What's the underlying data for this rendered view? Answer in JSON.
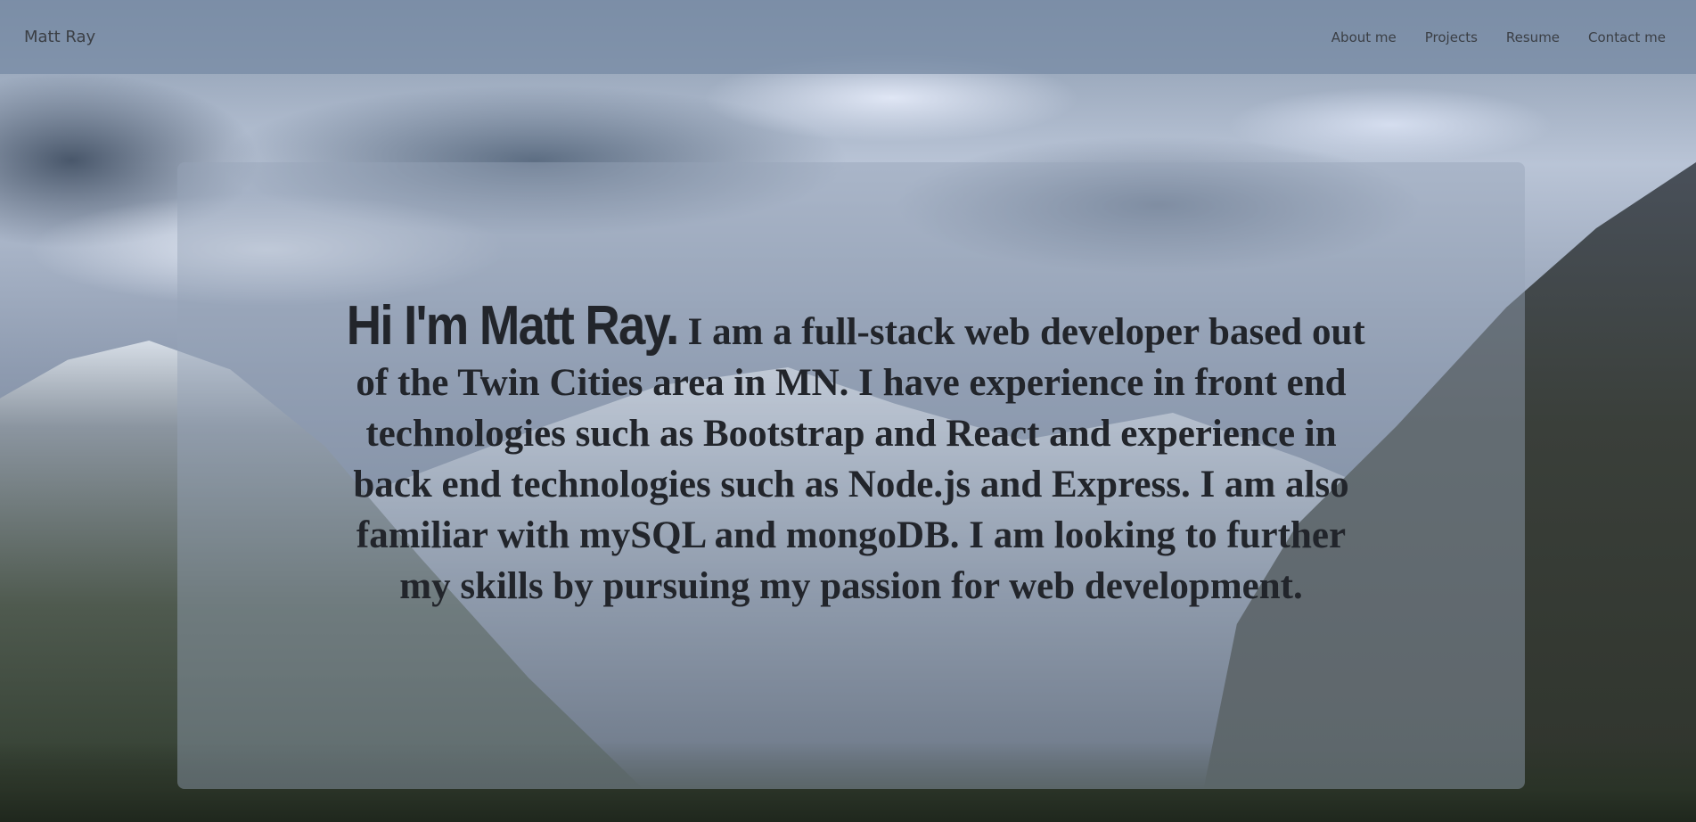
{
  "navbar": {
    "brand": "Matt Ray",
    "links": [
      {
        "label": "About me"
      },
      {
        "label": "Projects"
      },
      {
        "label": "Resume"
      },
      {
        "label": "Contact me"
      }
    ]
  },
  "hero": {
    "greeting": "Hi I'm Matt Ray.",
    "bio": "I am a full-stack web developer based out of the Twin Cities area in MN. I have experience in front end technologies such as Bootstrap and React and experience in back end technologies such as Node.js and Express. I am also familiar with mySQL and mongoDB. I am looking to further my skills by pursuing my passion for web development."
  },
  "colors": {
    "navbar_bg": "#788ca5",
    "text": "#22252b",
    "nav_text": "#3b3f45"
  }
}
